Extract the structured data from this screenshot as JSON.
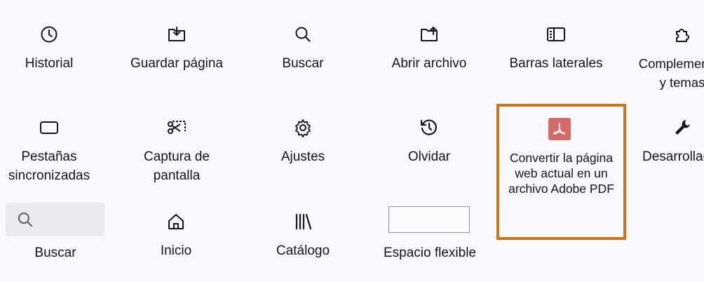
{
  "palette": {
    "items": [
      {
        "label": "Historial",
        "icon": "history-icon"
      },
      {
        "label": "Guardar página",
        "icon": "save-page-icon"
      },
      {
        "label": "Buscar",
        "icon": "search-icon"
      },
      {
        "label": "Abrir archivo",
        "icon": "open-file-icon"
      },
      {
        "label": "Barras laterales",
        "icon": "sidebars-icon"
      },
      {
        "label": "Complementos\ny temas",
        "icon": "extensions-icon"
      },
      {
        "label": "Pestañas\nsincronizadas",
        "icon": "synced-tabs-icon"
      },
      {
        "label": "Captura de\npantalla",
        "icon": "screenshot-icon"
      },
      {
        "label": "Ajustes",
        "icon": "settings-gear-icon"
      },
      {
        "label": "Olvidar",
        "icon": "forget-icon"
      },
      {
        "label": "Convertir la página\nweb actual en un\narchivo Adobe PDF",
        "icon": "adobe-pdf-icon"
      },
      {
        "label": "Desarrollador",
        "icon": "wrench-icon"
      },
      {
        "label": "Buscar",
        "icon": "search-widget-icon"
      },
      {
        "label": "Inicio",
        "icon": "home-icon"
      },
      {
        "label": "Catálogo",
        "icon": "library-icon"
      },
      {
        "label": "Espacio flexible",
        "icon": "flexible-space"
      }
    ]
  },
  "colors": {
    "highlight_border": "#c87718",
    "pdf_icon_bg": "#d46b6b"
  }
}
